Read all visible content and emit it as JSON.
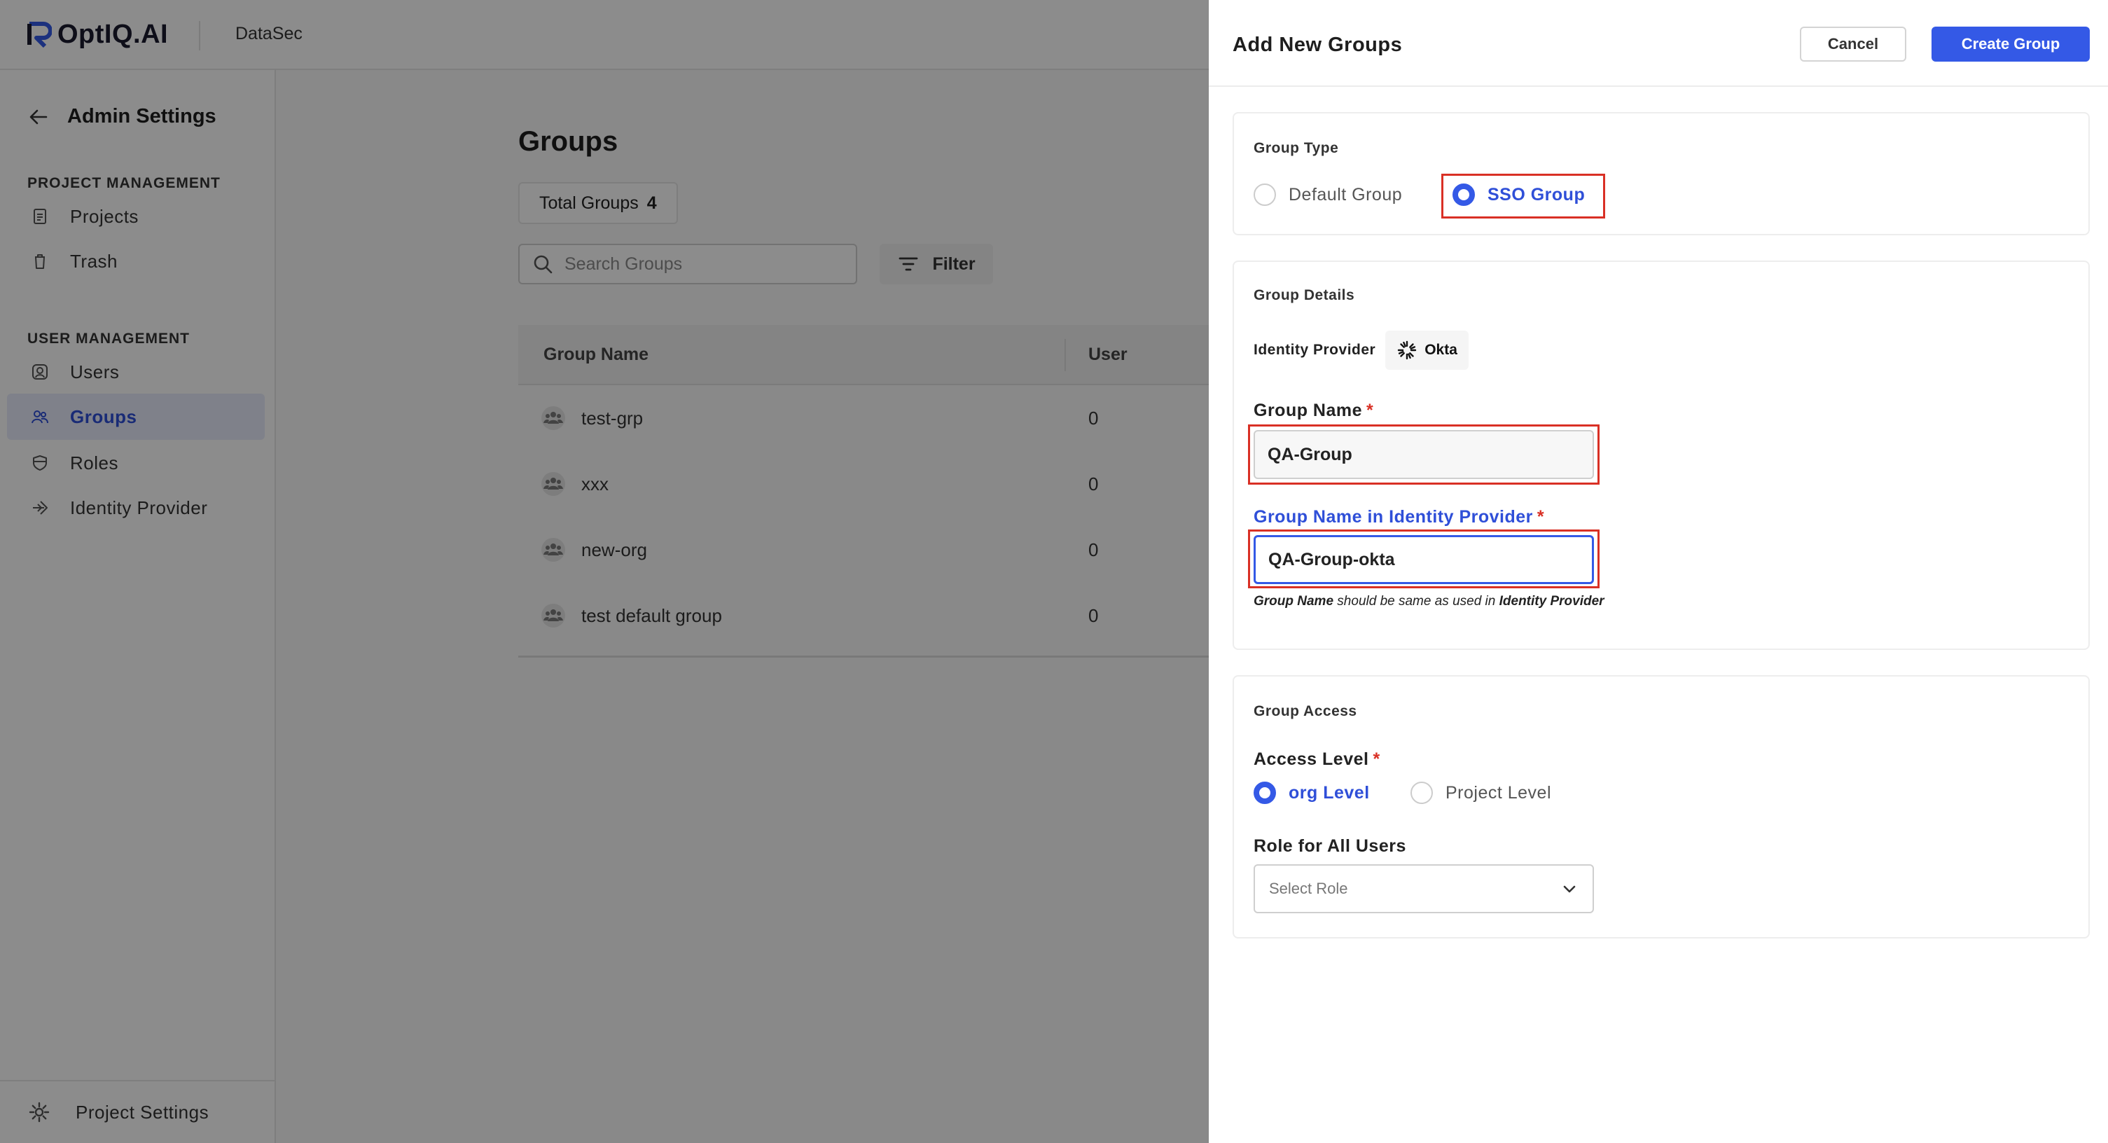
{
  "app": {
    "brand": "OptIQ.AI",
    "product": "DataSec"
  },
  "sidebar": {
    "title": "Admin Settings",
    "sections": [
      {
        "label": "PROJECT MANAGEMENT"
      },
      {
        "label": "USER MANAGEMENT"
      }
    ],
    "items": [
      {
        "label": "Projects",
        "icon": "document-icon"
      },
      {
        "label": "Trash",
        "icon": "trash-icon"
      },
      {
        "label": "Users",
        "icon": "user-icon"
      },
      {
        "label": "Groups",
        "icon": "group-icon",
        "active": true
      },
      {
        "label": "Roles",
        "icon": "shield-icon"
      },
      {
        "label": "Identity Provider",
        "icon": "login-icon"
      }
    ],
    "footer": {
      "label": "Project Settings",
      "icon": "gear-icon"
    }
  },
  "groups_page": {
    "title": "Groups",
    "total_label": "Total Groups",
    "total_count": "4",
    "search_placeholder": "Search Groups",
    "filter_label": "Filter",
    "columns": [
      "Group Name",
      "User"
    ],
    "rows": [
      {
        "name": "test-grp",
        "users": "0"
      },
      {
        "name": "xxx",
        "users": "0"
      },
      {
        "name": "new-org",
        "users": "0"
      },
      {
        "name": "test default group",
        "users": "0"
      }
    ]
  },
  "drawer": {
    "title": "Add New Groups",
    "cancel_label": "Cancel",
    "create_label": "Create Group",
    "group_type": {
      "section_label": "Group Type",
      "options": [
        "Default Group",
        "SSO Group"
      ],
      "selected": "SSO Group"
    },
    "group_details": {
      "section_label": "Group Details",
      "identity_provider_label": "Identity Provider",
      "identity_provider_value": "Okta",
      "group_name_label": "Group Name",
      "group_name_value": "QA-Group",
      "idp_group_name_label": "Group Name in Identity Provider",
      "idp_group_name_value": "QA-Group-okta",
      "hint_strong_1": "Group Name",
      "hint_middle": " should be same as used in ",
      "hint_strong_2": "Identity Provider",
      "required_mark": "*"
    },
    "group_access": {
      "section_label": "Group Access",
      "access_level_label": "Access Level",
      "access_options": [
        "org Level",
        "Project Level"
      ],
      "access_selected": "org Level",
      "role_label": "Role for All Users",
      "role_placeholder": "Select Role"
    }
  },
  "colors": {
    "accent": "#3459e6",
    "highlight": "#d93025",
    "overlay": "rgba(0,0,0,0.45)"
  }
}
